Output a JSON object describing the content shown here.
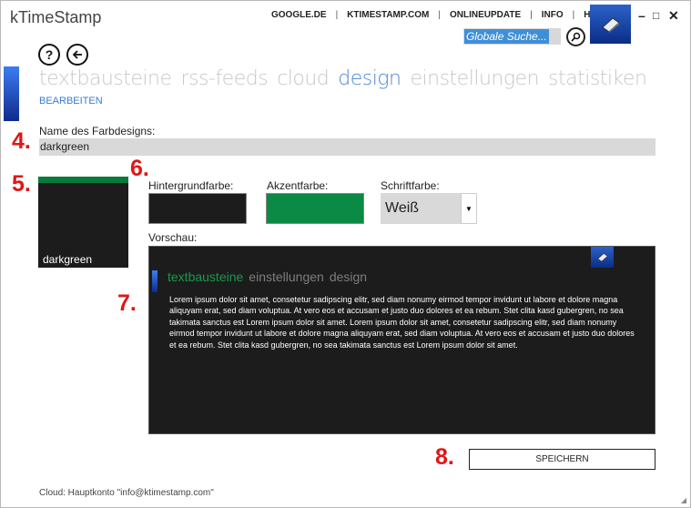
{
  "app": {
    "title": "kTimeStamp"
  },
  "toplinks": [
    "GOOGLE.DE",
    "KTIMESTAMP.COM",
    "ONLINEUPDATE",
    "INFO",
    "HILFE"
  ],
  "search": {
    "placeholder": "Globale Suche..."
  },
  "window_controls": {
    "minimize": "–",
    "maximize": "□",
    "close": "✕"
  },
  "nav": {
    "items": [
      "textbausteine",
      "rss-feeds",
      "cloud",
      "design",
      "einstellungen",
      "statistiken"
    ],
    "active": "design",
    "sub": "BEARBEITEN"
  },
  "steps": {
    "s4": "4.",
    "s5": "5.",
    "s6": "6.",
    "s7": "7.",
    "s8": "8."
  },
  "form": {
    "name_label": "Name des Farbdesigns:",
    "name_value": "darkgreen",
    "tile_label": "darkgreen",
    "bg_label": "Hintergrundfarbe:",
    "accent_label": "Akzentfarbe:",
    "font_label": "Schriftfarbe:",
    "font_value": "Weiß",
    "preview_label": "Vorschau:",
    "save_label": "SPEICHERN"
  },
  "colors": {
    "background": "#1c1c1c",
    "accent": "#0a8a45",
    "font": "#ffffff",
    "app_accent": "#4f86d8"
  },
  "preview": {
    "nav": [
      "textbausteine",
      "einstellungen",
      "design"
    ],
    "active": "textbausteine",
    "text": "Lorem ipsum dolor sit amet, consetetur sadipscing elitr, sed diam nonumy eirmod tempor invidunt ut labore et dolore magna aliquyam erat, sed diam voluptua. At vero eos et accusam et justo duo dolores et ea rebum. Stet clita kasd gubergren, no sea takimata sanctus est Lorem ipsum dolor sit amet. Lorem ipsum dolor sit amet, consetetur sadipscing elitr, sed diam nonumy eirmod tempor invidunt ut labore et dolore magna aliquyam erat, sed diam voluptua. At vero eos et accusam et justo duo dolores et ea rebum. Stet clita kasd gubergren, no sea takimata sanctus est Lorem ipsum dolor sit amet."
  },
  "footer": {
    "text": "Cloud: Hauptkonto \"info@ktimestamp.com\""
  }
}
